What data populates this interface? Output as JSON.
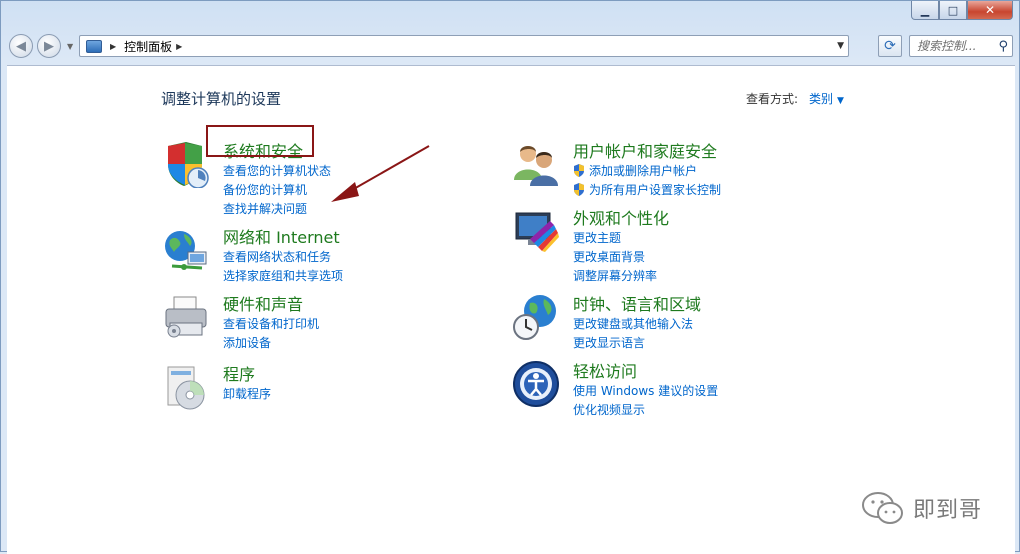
{
  "window": {
    "caption_min": "▭",
    "caption_max": "□",
    "caption_close": "✕"
  },
  "nav": {
    "breadcrumb": "控制面板",
    "search_placeholder": "搜索控制...",
    "back_icon": "arrow-left",
    "forward_icon": "arrow-right",
    "refresh_icon": "refresh"
  },
  "main": {
    "title": "调整计算机的设置",
    "view_by_label": "查看方式:",
    "view_by_value": "类别"
  },
  "categories": [
    {
      "title": "系统和安全",
      "icon": "shield-icon",
      "links": [
        "查看您的计算机状态",
        "备份您的计算机",
        "查找并解决问题"
      ]
    },
    {
      "title": "网络和 Internet",
      "icon": "network-globe-icon",
      "links": [
        "查看网络状态和任务",
        "选择家庭组和共享选项"
      ]
    },
    {
      "title": "硬件和声音",
      "icon": "printer-icon",
      "links": [
        "查看设备和打印机",
        "添加设备"
      ]
    },
    {
      "title": "程序",
      "icon": "programs-disc-icon",
      "links": [
        "卸载程序"
      ]
    },
    {
      "title": "用户帐户和家庭安全",
      "icon": "users-icon",
      "links": [
        "添加或删除用户帐户",
        "为所有用户设置家长控制"
      ]
    },
    {
      "title": "外观和个性化",
      "icon": "display-palette-icon",
      "links": [
        "更改主题",
        "更改桌面背景",
        "调整屏幕分辨率"
      ]
    },
    {
      "title": "时钟、语言和区域",
      "icon": "clock-globe-icon",
      "links": [
        "更改键盘或其他输入法",
        "更改显示语言"
      ]
    },
    {
      "title": "轻松访问",
      "icon": "accessibility-icon",
      "links": [
        "使用 Windows 建议的设置",
        "优化视频显示"
      ]
    }
  ],
  "watermark": {
    "text": "即到哥"
  },
  "colors": {
    "link": "#0066cc",
    "category_title": "#1e7a1e",
    "highlight": "#8a1616"
  }
}
